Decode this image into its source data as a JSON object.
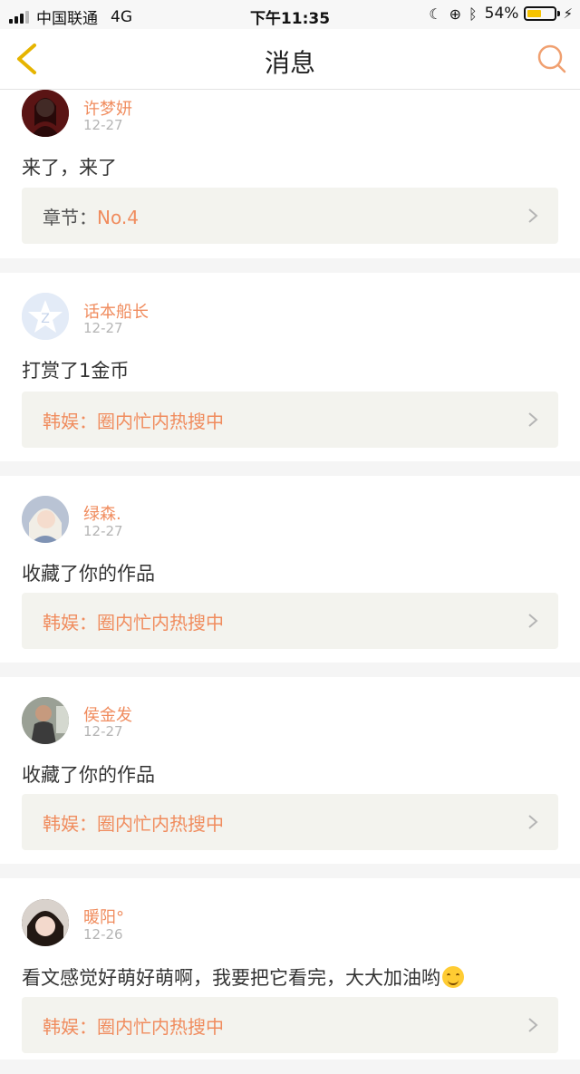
{
  "status_bar": {
    "carrier": "中国联通",
    "network": "4G",
    "time": "下午11:35",
    "battery": "54%",
    "battery_level": 0.54
  },
  "header": {
    "title": "消息"
  },
  "messages": [
    {
      "user": "许梦妍",
      "date": "12-27",
      "text": "来了，来了",
      "ref_prefix": "章节：",
      "ref_value": "No.4",
      "avatar_color": "#7a1f1f"
    },
    {
      "user": "话本船长",
      "date": "12-27",
      "text": "打赏了1金币",
      "ref_prefix": "韩娱：",
      "ref_value": "圈内忙内热搜中",
      "avatar_color": "#dfe8f6"
    },
    {
      "user": "绿森.",
      "date": "12-27",
      "text": "收藏了你的作品",
      "ref_prefix": "韩娱：",
      "ref_value": "圈内忙内热搜中",
      "avatar_color": "#cfd6e3"
    },
    {
      "user": "侯金发",
      "date": "12-27",
      "text": "收藏了你的作品",
      "ref_prefix": "韩娱：",
      "ref_value": "圈内忙内热搜中",
      "avatar_color": "#8a8f84"
    },
    {
      "user": "暖阳°",
      "date": "12-26",
      "text": "看文感觉好萌好萌啊，我要把它看完，大大加油哟",
      "ref_prefix": "韩娱：",
      "ref_value": "圈内忙内热搜中",
      "avatar_color": "#3a2a22"
    }
  ],
  "colors": {
    "accent": "#f08c5e",
    "back_icon": "#e6b400"
  }
}
